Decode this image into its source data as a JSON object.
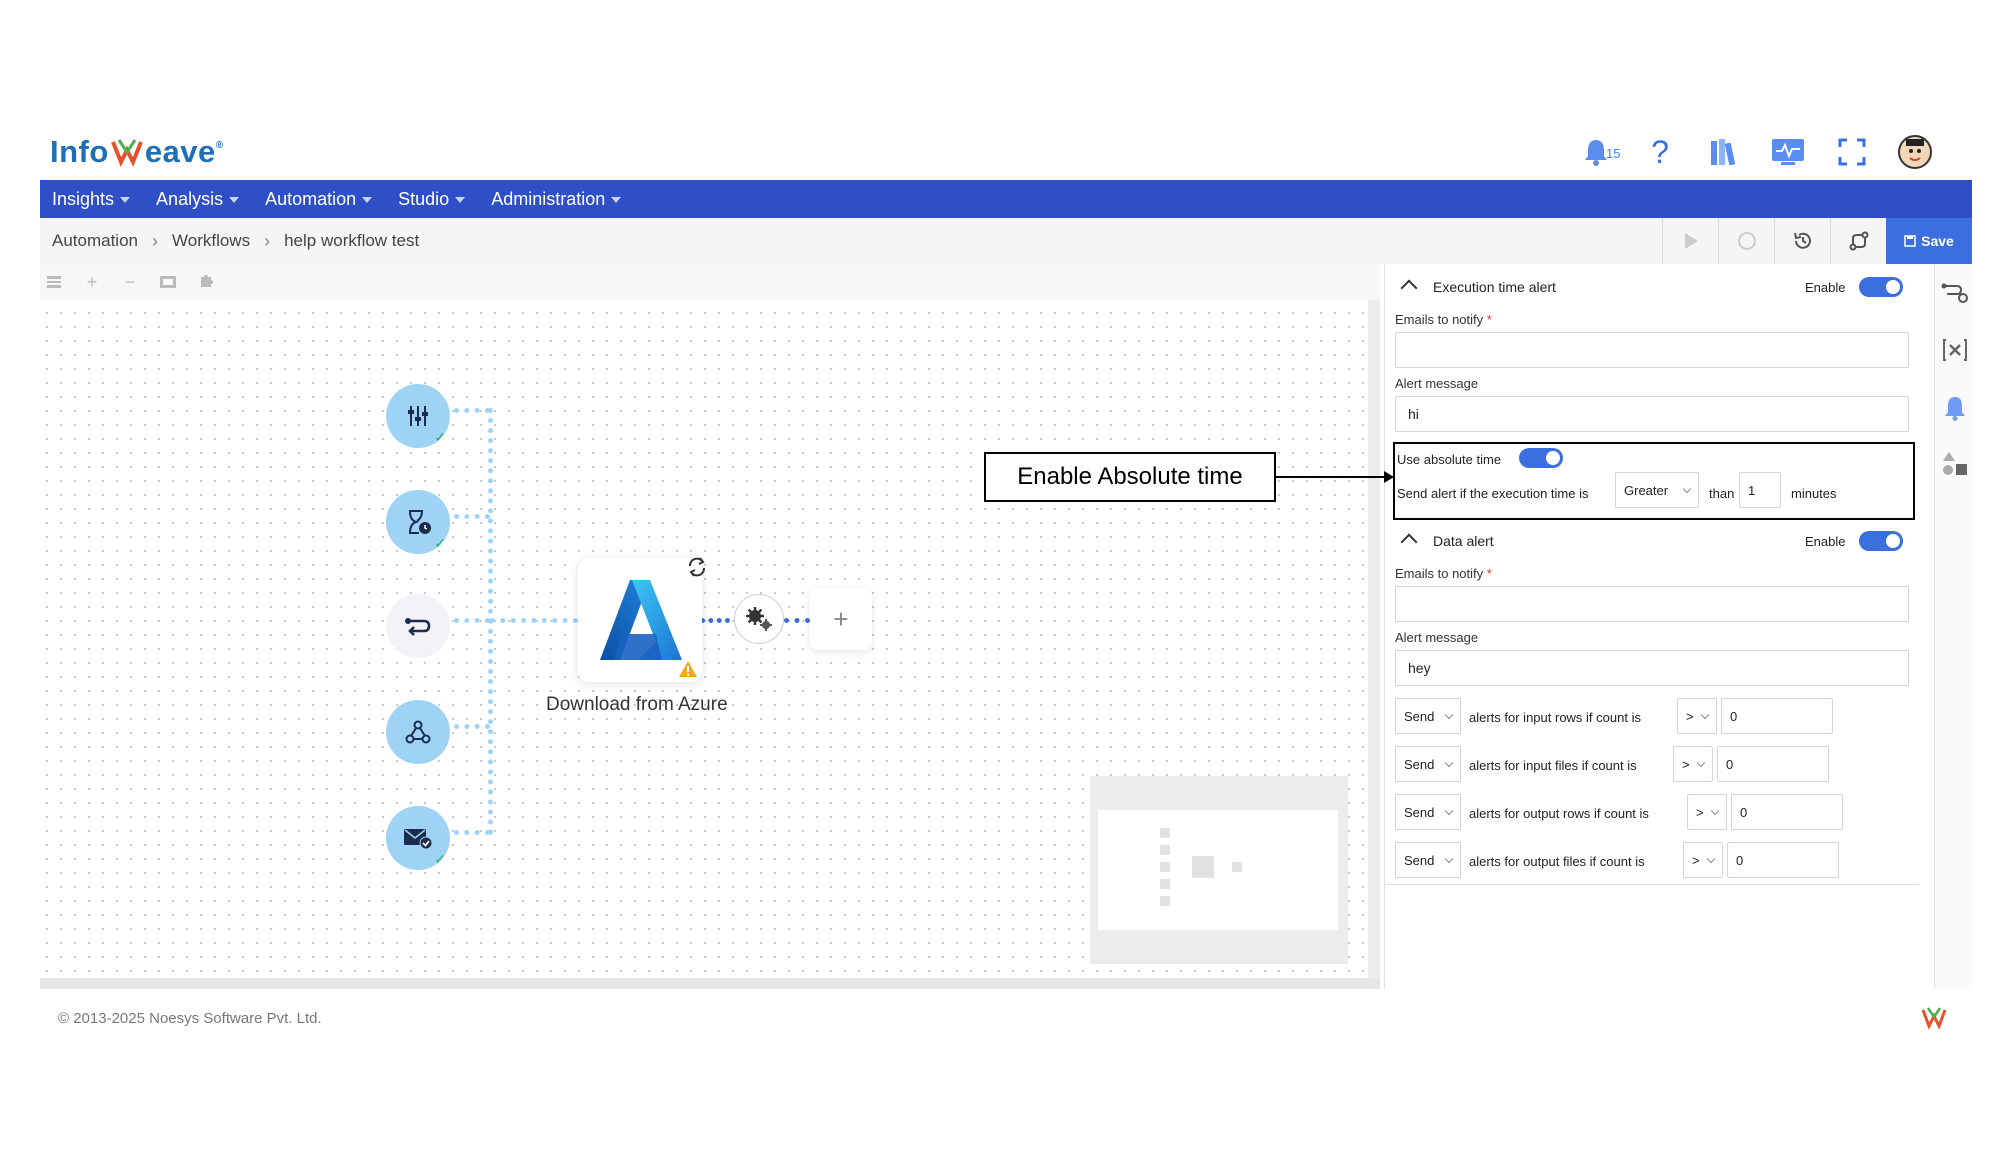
{
  "brand": {
    "logo_text_left": "Info",
    "logo_text_right": "eave",
    "registered": "®"
  },
  "header": {
    "notification_count": "15",
    "icons": [
      "bell-icon",
      "help-icon",
      "library-icon",
      "monitor-icon",
      "fullscreen-icon",
      "user-avatar"
    ]
  },
  "menu": [
    {
      "label": "Insights"
    },
    {
      "label": "Analysis"
    },
    {
      "label": "Automation"
    },
    {
      "label": "Studio"
    },
    {
      "label": "Administration"
    }
  ],
  "breadcrumb": {
    "items": [
      "Automation",
      "Workflows",
      "help workflow test"
    ]
  },
  "toolbar": {
    "save_label": "Save"
  },
  "canvas": {
    "node_label": "Download from Azure",
    "plus_label": "+",
    "tools": [
      "collapse-tool",
      "zoom-in-tool",
      "zoom-out-tool",
      "fit-tool",
      "settings-tool"
    ]
  },
  "callout": {
    "text": "Enable Absolute time"
  },
  "execution_alert": {
    "title": "Execution time alert",
    "enable_label": "Enable",
    "enabled": true,
    "emails_label": "Emails to notify",
    "required_mark": "*",
    "emails_value": "",
    "message_label": "Alert message",
    "message_value": "hi",
    "absolute_time_label": "Use absolute time",
    "absolute_time_enabled": true,
    "send_text": "Send alert if the execution time is",
    "comparison": "Greater",
    "than_text": "than",
    "minutes_value": "1",
    "minutes_text": "minutes"
  },
  "data_alert": {
    "title": "Data alert",
    "enable_label": "Enable",
    "enabled": true,
    "emails_label": "Emails to notify",
    "required_mark": "*",
    "emails_value": "",
    "message_label": "Alert message",
    "message_value": "hey",
    "rows": [
      {
        "action": "Send",
        "text": "alerts for input rows  if count is",
        "op": ">",
        "value": "0"
      },
      {
        "action": "Send",
        "text": "alerts for input files  if count is",
        "op": ">",
        "value": "0"
      },
      {
        "action": "Send",
        "text": "alerts for output rows  if count is",
        "op": ">",
        "value": "0"
      },
      {
        "action": "Send",
        "text": "alerts for output files  if count is",
        "op": ">",
        "value": "0"
      }
    ]
  },
  "footer": {
    "copyright": "© 2013-2025 Noesys Software Pvt. Ltd."
  },
  "colors": {
    "brand_blue": "#2f4fc9",
    "accent": "#3b6fe0",
    "node_fill": "#9ed3f5",
    "success": "#22b45a"
  }
}
